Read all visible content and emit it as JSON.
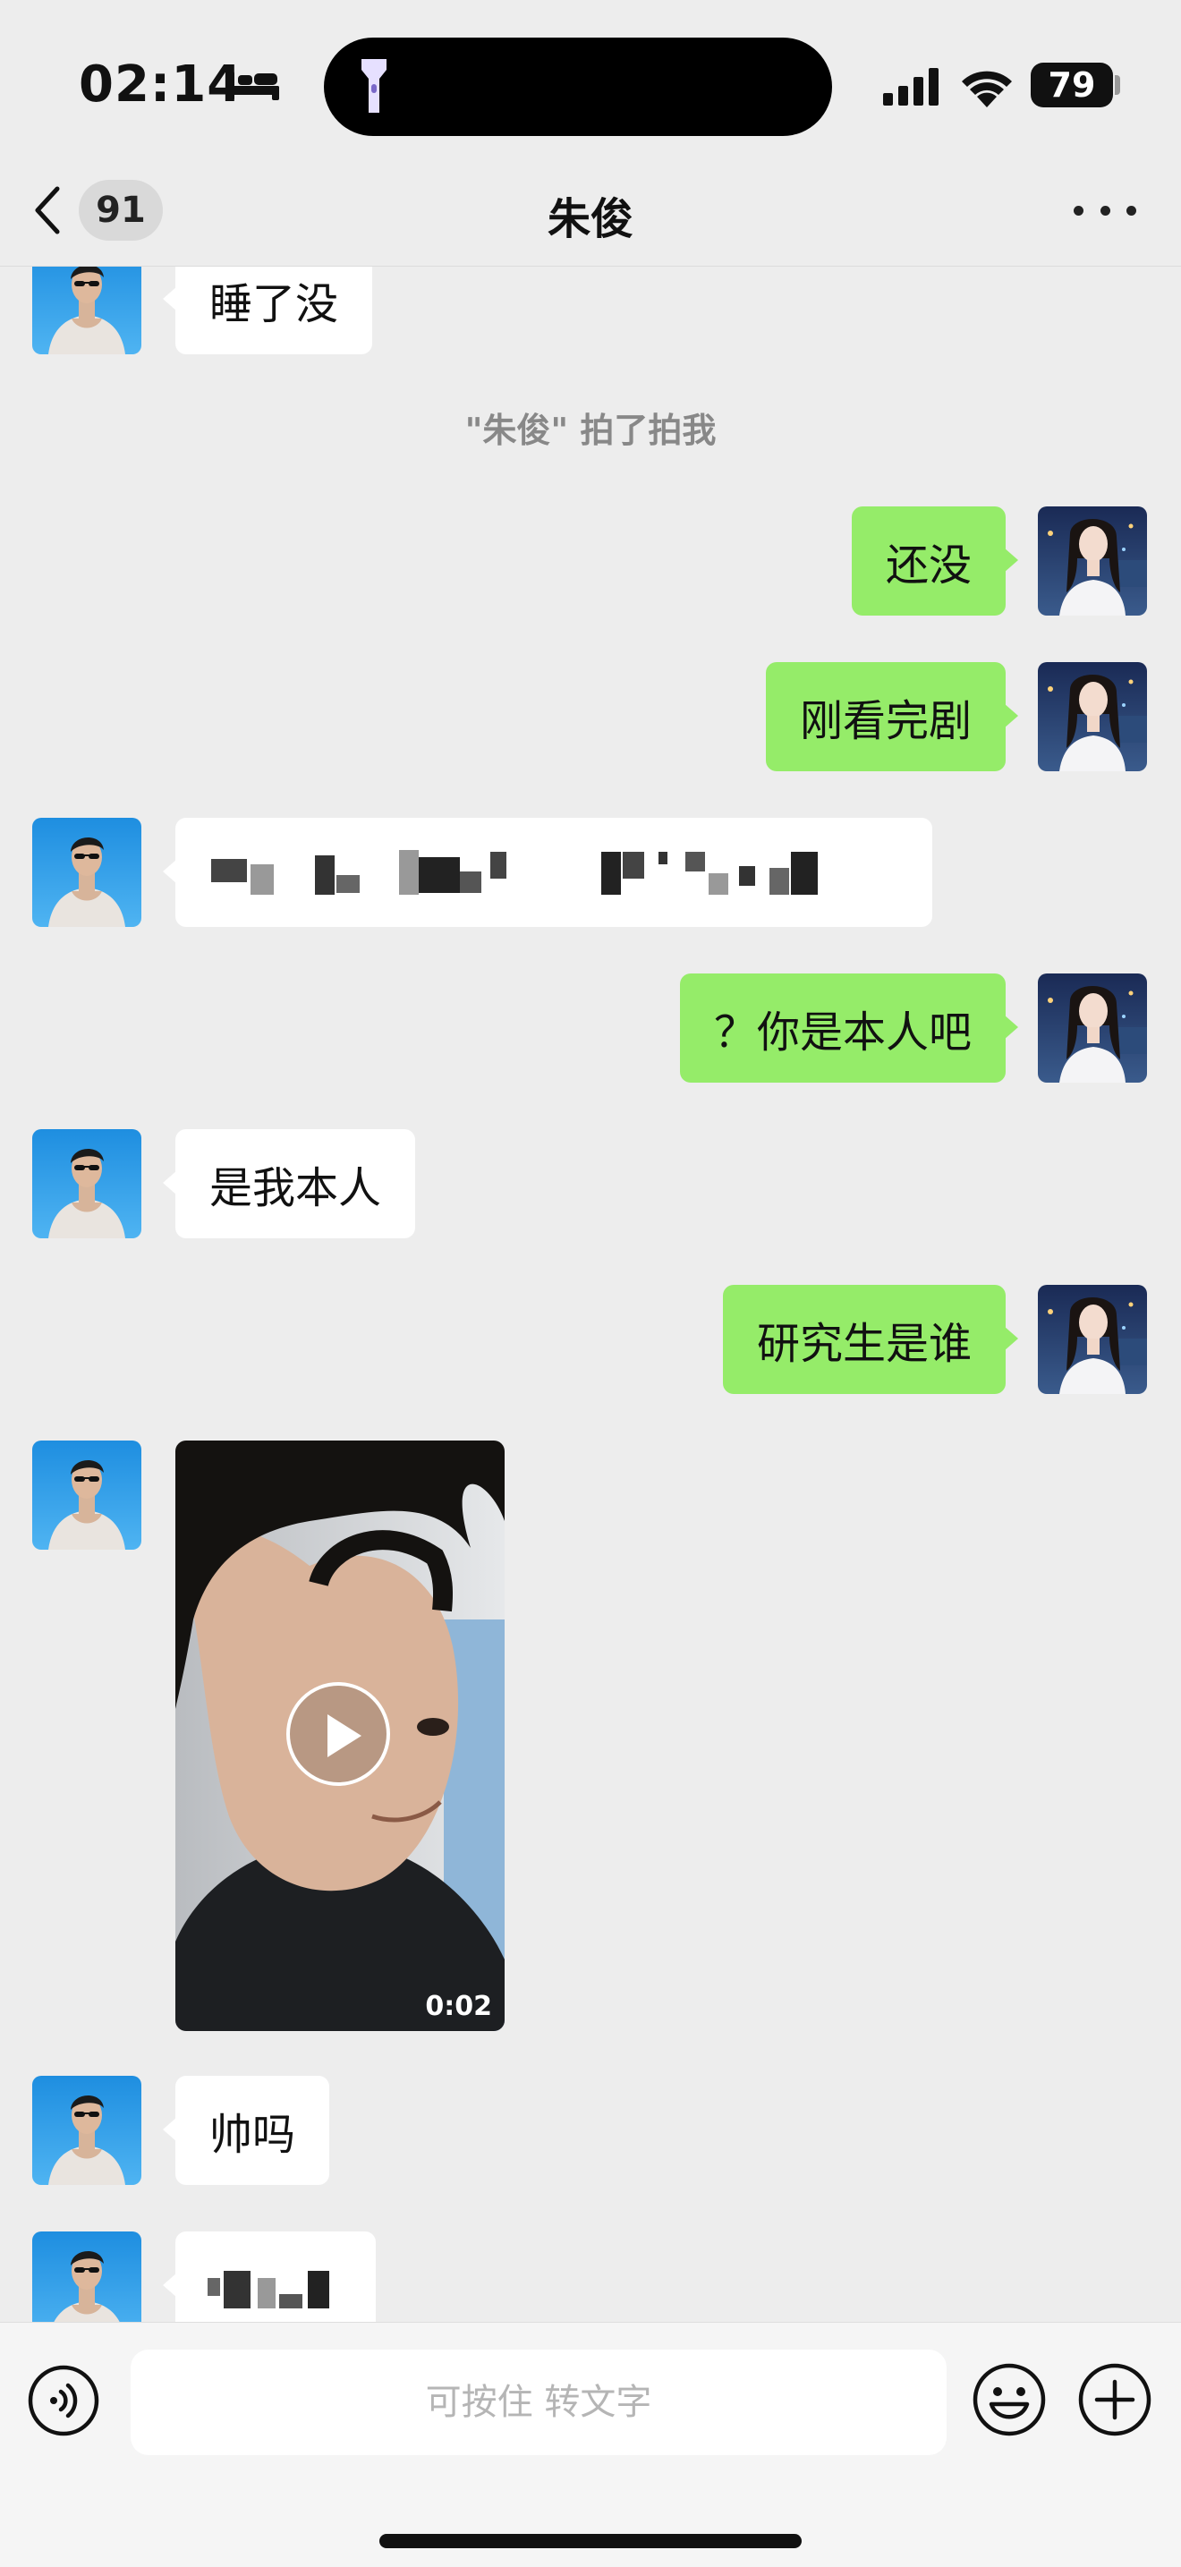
{
  "status_bar": {
    "time": "02:14",
    "battery": "79",
    "icons": [
      "sleep-bed-icon",
      "flashlight-icon",
      "signal-icon",
      "wifi-icon",
      "battery-icon"
    ]
  },
  "nav": {
    "unread_count": "91",
    "title": "朱俊",
    "icons": [
      "chevron-left-icon",
      "more-dots-icon"
    ]
  },
  "messages": {
    "m1": {
      "sender": "contact",
      "text": "睡了没"
    },
    "system": {
      "text": "\"朱俊\" 拍了拍我"
    },
    "m2": {
      "sender": "me",
      "text": "还没"
    },
    "m3": {
      "sender": "me",
      "text": "刚看完剧"
    },
    "m4": {
      "sender": "contact",
      "text": "(pixelated)"
    },
    "m5": {
      "sender": "me",
      "text": "？你是本人吧"
    },
    "m6": {
      "sender": "contact",
      "text": "是我本人"
    },
    "m7": {
      "sender": "me",
      "text": "研究生是谁"
    },
    "m8": {
      "sender": "contact",
      "type": "video",
      "duration": "0:02"
    },
    "m9": {
      "sender": "contact",
      "text": "帅吗"
    },
    "m10": {
      "sender": "contact",
      "text": "(pixelated)"
    }
  },
  "input_bar": {
    "placeholder": "可按住 转文字",
    "icons": [
      "voice-icon",
      "emoji-icon",
      "plus-icon"
    ]
  },
  "colors": {
    "background": "#ededed",
    "outgoing_bubble": "#95ec69",
    "incoming_bubble": "#ffffff"
  }
}
